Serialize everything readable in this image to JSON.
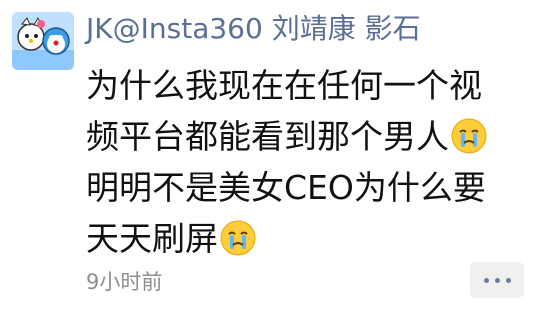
{
  "comment": {
    "author": "JK@Insta360 刘靖康 影石",
    "avatar_icon": "hello-kitty-doraemon-avatar",
    "text": {
      "part1": "为什么我现在在任何一个视频平台都能看到那个男人",
      "part2": " 明明不是美女CEO为什么要天天刷屏"
    },
    "emoji": "crying-face-icon",
    "time": "9小时前",
    "more_icon": "more-dots-icon"
  },
  "colors": {
    "author": "#5a6f93",
    "time": "#8e8e8e",
    "more_button_bg": "#f0f0f0"
  }
}
